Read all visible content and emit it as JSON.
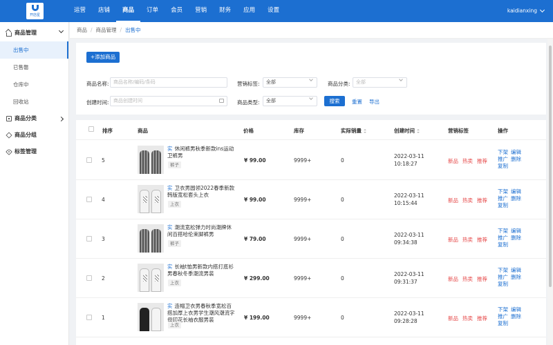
{
  "app": {
    "logo_text": "开店星"
  },
  "nav": {
    "items": [
      "运营",
      "店铺",
      "商品",
      "订单",
      "会员",
      "营销",
      "财务",
      "应用",
      "设置"
    ],
    "active": "商品"
  },
  "user": {
    "name": "kaidianxing"
  },
  "sidebar": {
    "group_goods": "商品管理",
    "items": [
      "出售中",
      "已售罄",
      "仓库中",
      "回收站"
    ],
    "active_item": "出售中",
    "group_category": "商品分类",
    "group_group": "商品分组",
    "group_tags": "标签管理"
  },
  "breadcrumb": [
    "商品",
    "商品管理",
    "出售中"
  ],
  "toolbar": {
    "add_label": "+添加商品"
  },
  "filters": {
    "name_label": "商品名称:",
    "name_placeholder": "商品名称/编码/条码",
    "tag_label": "营销标签:",
    "tag_value": "全部",
    "category_label": "商品分类:",
    "category_value": "全部",
    "time_label": "创建时间:",
    "time_placeholder": "商品创建时间",
    "type_label": "商品类型:",
    "type_value": "全部",
    "search_label": "搜索",
    "reset_label": "重置",
    "export_label": "导出"
  },
  "table": {
    "headers": {
      "sort": "排序",
      "product": "商品",
      "price": "价格",
      "stock": "库存",
      "sales": "实际销量",
      "created": "创建时间",
      "tags": "营销标签",
      "actions": "操作"
    },
    "rows": [
      {
        "sort": "5",
        "badge": "实",
        "title": "休闲裤男秋季新款ins运动卫裤男",
        "category": "裤子",
        "price": "¥ 99.00",
        "stock": "9999+",
        "sales": "0",
        "date": "2022-03-11",
        "time": "10:18:27",
        "tags": [
          "新品",
          "热卖",
          "推荐"
        ],
        "actions": [
          "下架",
          "编辑",
          "推广",
          "删除",
          "复制"
        ]
      },
      {
        "sort": "4",
        "badge": "实",
        "title": "卫衣男圆领2022春季新款韩版宽松套头上衣",
        "category": "上衣",
        "price": "¥ 99.00",
        "stock": "9999+",
        "sales": "0",
        "date": "2022-03-11",
        "time": "10:15:44",
        "tags": [
          "新品",
          "热卖",
          "推荐"
        ],
        "actions": [
          "下架",
          "编辑",
          "推广",
          "删除",
          "复制"
        ]
      },
      {
        "sort": "3",
        "badge": "实",
        "title": "潮流宽松弹力时尚潮牌休闲百搭哈伦束脚裤男",
        "category": "裤子",
        "price": "¥ 79.00",
        "stock": "9999+",
        "sales": "0",
        "date": "2022-03-11",
        "time": "09:34:38",
        "tags": [
          "新品",
          "热卖",
          "推荐"
        ],
        "actions": [
          "下架",
          "编辑",
          "推广",
          "删除",
          "复制"
        ]
      },
      {
        "sort": "2",
        "badge": "实",
        "title": "长袖t恤男新款内搭打底衫男春秋冬季潮流男装",
        "category": "上衣",
        "price": "¥ 299.00",
        "stock": "9999+",
        "sales": "0",
        "date": "2022-03-11",
        "time": "09:31:37",
        "tags": [
          "新品",
          "热卖",
          "推荐"
        ],
        "actions": [
          "下架",
          "编辑",
          "推广",
          "删除",
          "复制"
        ]
      },
      {
        "sort": "1",
        "badge": "实",
        "title": "连帽卫衣男春秋季宽松百搭加厚上衣男学生潮风潮流字母印花长袖衣服男装",
        "category": "上衣",
        "price": "¥ 199.00",
        "stock": "9999+",
        "sales": "0",
        "date": "2022-03-11",
        "time": "09:28:28",
        "tags": [
          "新品",
          "热卖",
          "推荐"
        ],
        "actions": [
          "下架",
          "编辑",
          "推广",
          "删除",
          "复制"
        ]
      }
    ]
  },
  "colors": {
    "primary": "#1c6fd1",
    "tag_red": "#e54545"
  }
}
